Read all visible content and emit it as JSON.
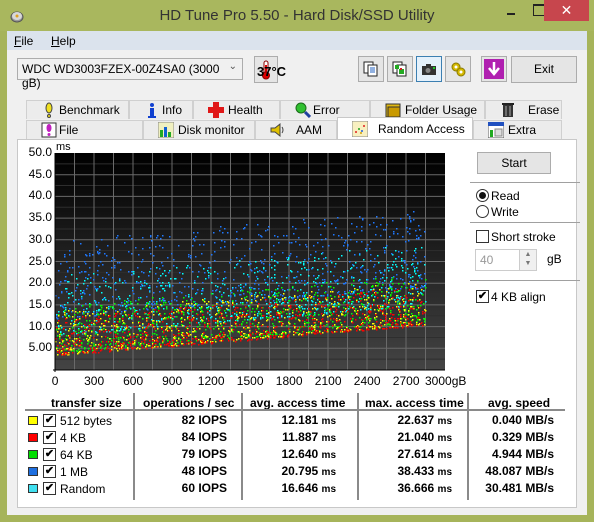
{
  "window": {
    "title": "HD Tune Pro 5.50 - Hard Disk/SSD Utility",
    "close_glyph": "✕"
  },
  "menu": {
    "items": [
      {
        "label": "File",
        "mnemonic": "F",
        "rest": "ile"
      },
      {
        "label": "Help",
        "mnemonic": "H",
        "rest": "elp"
      }
    ]
  },
  "toolbar": {
    "drive": "WDC WD3003FZEX-00Z4SA0 (3000 gB)",
    "temperature": "37°C",
    "buttons": [
      "copy-text-icon",
      "copy-image-icon",
      "screenshot-icon",
      "options-icon",
      "save-icon"
    ],
    "exit_label": "Exit"
  },
  "tabs": {
    "row1": [
      {
        "label": "Benchmark",
        "icon": "benchmark-icon"
      },
      {
        "label": "Info",
        "icon": "info-icon"
      },
      {
        "label": "Health",
        "icon": "health-icon"
      },
      {
        "label": "Error Scan",
        "icon": "error-scan-icon"
      },
      {
        "label": "Folder Usage",
        "icon": "folder-icon"
      },
      {
        "label": "Erase",
        "icon": "trash-icon"
      }
    ],
    "row2": [
      {
        "label": "File Benchmark",
        "icon": "file-benchmark-icon"
      },
      {
        "label": "Disk monitor",
        "icon": "disk-monitor-icon"
      },
      {
        "label": "AAM",
        "icon": "speaker-icon"
      },
      {
        "label": "Random Access",
        "icon": "random-access-icon",
        "active": true
      },
      {
        "label": "Extra tests",
        "icon": "extra-tests-icon"
      }
    ]
  },
  "controls": {
    "start_label": "Start",
    "read_label": "Read",
    "write_label": "Write",
    "mode": "Read",
    "short_stroke_label": "Short stroke",
    "short_stroke_checked": false,
    "short_stroke_value": "40",
    "short_stroke_unit": "gB",
    "align_label": "4 KB align",
    "align_checked": true
  },
  "chart_data": {
    "type": "scatter",
    "title": "",
    "ylabel": "ms",
    "xlabel": "gB",
    "ylim": [
      0,
      50
    ],
    "xlim": [
      0,
      3000
    ],
    "grid": true,
    "yticks": [
      "50.0",
      "45.0",
      "40.0",
      "35.0",
      "30.0",
      "25.0",
      "20.0",
      "15.0",
      "10.0",
      "5.00"
    ],
    "ytick_values": [
      50,
      45,
      40,
      35,
      30,
      25,
      20,
      15,
      10,
      5
    ],
    "xticks": [
      "0",
      "300",
      "600",
      "900",
      "1200",
      "1500",
      "1800",
      "2100",
      "2400",
      "2700",
      "3000gB"
    ],
    "xtick_values": [
      0,
      300,
      600,
      900,
      1200,
      1500,
      1800,
      2100,
      2400,
      2700,
      3000
    ],
    "data_extent_gB": 2850,
    "series": [
      {
        "name": "512 bytes",
        "color": "#ffff00",
        "avg_ms": 12.181,
        "max_ms": 22.637,
        "min_base_ms": 3.5,
        "spread_ms": 10
      },
      {
        "name": "4 KB",
        "color": "#ff0000",
        "avg_ms": 11.887,
        "max_ms": 21.04,
        "min_base_ms": 3.3,
        "spread_ms": 9
      },
      {
        "name": "64 KB",
        "color": "#00ff00",
        "avg_ms": 12.64,
        "max_ms": 27.614,
        "min_base_ms": 4.0,
        "spread_ms": 11
      },
      {
        "name": "1 MB",
        "color": "#1e78ff",
        "avg_ms": 20.795,
        "max_ms": 38.433,
        "min_base_ms": 12.0,
        "spread_ms": 18
      },
      {
        "name": "Random",
        "color": "#00ffff",
        "avg_ms": 16.646,
        "max_ms": 36.666,
        "min_base_ms": 8.0,
        "spread_ms": 14
      }
    ]
  },
  "results": {
    "headers": [
      "transfer size",
      "operations / sec",
      "avg. access time",
      "max. access time",
      "avg. speed"
    ],
    "rows": [
      {
        "size": "512 bytes",
        "color": "#ffff00",
        "checked": true,
        "iops": "82 IOPS",
        "avg": "12.181",
        "max": "22.637",
        "speed": "0.040 MB/s"
      },
      {
        "size": "4 KB",
        "color": "#ff0000",
        "checked": true,
        "iops": "84 IOPS",
        "avg": "11.887",
        "max": "21.040",
        "speed": "0.329 MB/s"
      },
      {
        "size": "64 KB",
        "color": "#00dd00",
        "checked": true,
        "iops": "79 IOPS",
        "avg": "12.640",
        "max": "27.614",
        "speed": "4.944 MB/s"
      },
      {
        "size": "1 MB",
        "color": "#1e6fe0",
        "checked": true,
        "iops": "48 IOPS",
        "avg": "20.795",
        "max": "38.433",
        "speed": "48.087 MB/s"
      },
      {
        "size": "Random",
        "color": "#40e0f0",
        "checked": true,
        "iops": "60 IOPS",
        "avg": "16.646",
        "max": "36.666",
        "speed": "30.481 MB/s"
      }
    ],
    "ms_unit": "ms",
    "check_glyph": "✔"
  }
}
